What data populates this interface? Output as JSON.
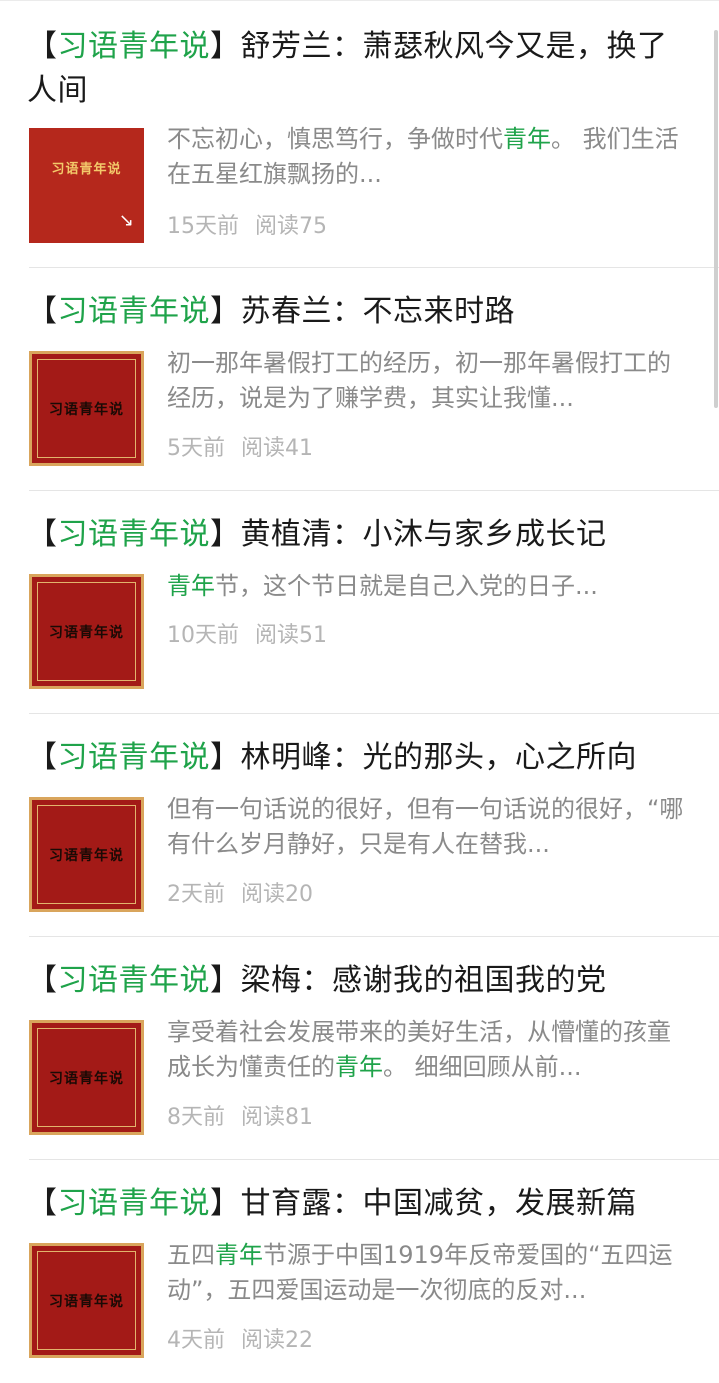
{
  "colors": {
    "accent": "#1fa34a",
    "text": "#1a1a1a",
    "muted": "#8a8a8a",
    "meta": "#b5b5b5",
    "thumb_red": "#a31a17",
    "thumb_border": "#d9a55c"
  },
  "thumb_label": "习语青年说",
  "icons": {
    "share_arrow": "↘"
  },
  "articles": [
    {
      "title_prefix": "【",
      "title_highlight": "习语青年说",
      "title_rest": "】舒芳兰：萧瑟秋风今又是，换了人间",
      "body_pre": "不忘初心，慎思笃行，争做时代",
      "body_hl": "青年",
      "body_post": "。 我们生活在五星红旗飘扬的...",
      "time": "15天前",
      "reads": "阅读75"
    },
    {
      "title_prefix": "【",
      "title_highlight": "习语青年说",
      "title_rest": "】苏春兰：不忘来时路",
      "body_pre": "初一那年暑假打工的经历，初一那年暑假打工的经历，说是为了赚学费，其实让我懂...",
      "body_hl": "",
      "body_post": "",
      "time": "5天前",
      "reads": "阅读41"
    },
    {
      "title_prefix": "【",
      "title_highlight": "习语青年说",
      "title_rest": "】黄植清：小沐与家乡成长记",
      "body_pre": "",
      "body_hl": "青年",
      "body_post": "节，这个节日就是自己入党的日子...",
      "time": "10天前",
      "reads": "阅读51"
    },
    {
      "title_prefix": "【",
      "title_highlight": "习语青年说",
      "title_rest": "】林明峰：光的那头，心之所向",
      "body_pre": "但有一句话说的很好，但有一句话说的很好，“哪有什么岁月静好，只是有人在替我...",
      "body_hl": "",
      "body_post": "",
      "time": "2天前",
      "reads": "阅读20"
    },
    {
      "title_prefix": "【",
      "title_highlight": "习语青年说",
      "title_rest": "】梁梅：感谢我的祖国我的党",
      "body_pre": "享受着社会发展带来的美好生活，从懵懂的孩童成长为懂责任的",
      "body_hl": "青年",
      "body_post": "。 细细回顾从前...",
      "time": "8天前",
      "reads": "阅读81"
    },
    {
      "title_prefix": "【",
      "title_highlight": "习语青年说",
      "title_rest": "】甘育露：中国减贫，发展新篇",
      "body_pre": "五四",
      "body_hl": "青年",
      "body_post": "节源于中国1919年反帝爱国的“五四运动”，五四爱国运动是一次彻底的反对...",
      "time": "4天前",
      "reads": "阅读22"
    }
  ]
}
